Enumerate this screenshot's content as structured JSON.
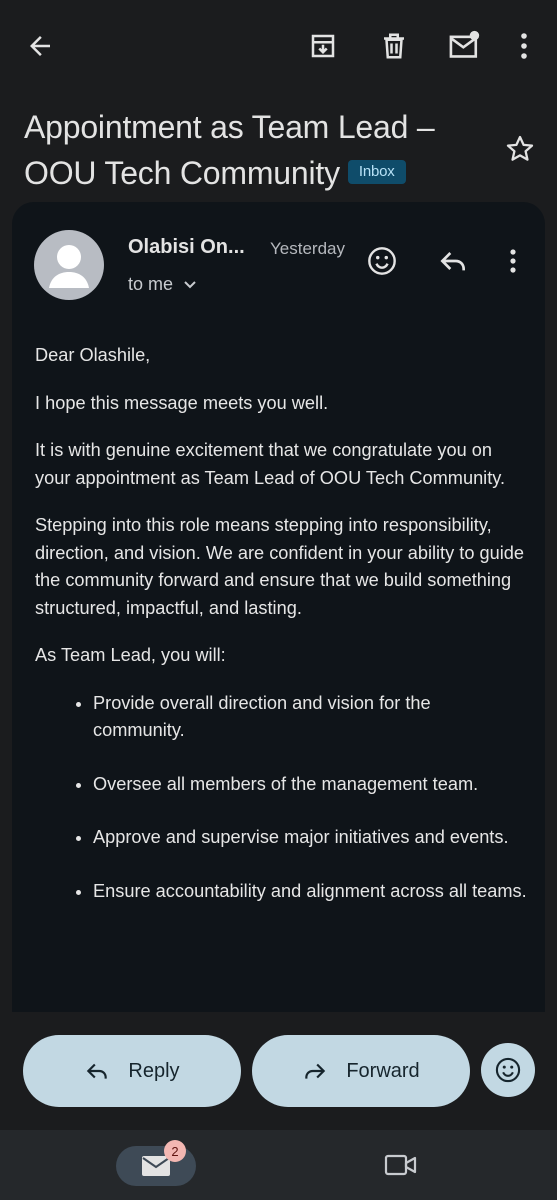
{
  "header": {
    "icons": [
      "back-arrow-icon",
      "archive-icon",
      "delete-icon",
      "mark-unread-icon",
      "more-vert-icon"
    ]
  },
  "subject": {
    "title": "Appointment as Team Lead – OOU Tech Community",
    "label": "Inbox"
  },
  "message": {
    "sender": "Olabisi On...",
    "date": "Yesterday",
    "recipient": "to me",
    "body": {
      "greeting": "Dear Olashile,",
      "p1": "I hope this message meets you well.",
      "p2": "It is with genuine excitement that we congratulate you on your appointment as Team Lead of OOU Tech Community.",
      "p3": "Stepping into this role means stepping into responsibility, direction, and vision. We are confident in your ability to guide the community forward and ensure that we build something structured, impactful, and lasting.",
      "p4": "As Team Lead, you will:",
      "bullets": [
        "Provide overall direction and vision for the community.",
        "Oversee all members of the management team.",
        "Approve and supervise major initiatives and events.",
        "Ensure accountability and alignment across all teams."
      ]
    }
  },
  "actions": {
    "reply": "Reply",
    "forward": "Forward"
  },
  "bottom_nav": {
    "mail_badge": "2"
  },
  "colors": {
    "background": "#1b1c1e",
    "card": "#0f1419",
    "pill": "#c2d8e3",
    "badge": "#0f4c6a"
  }
}
